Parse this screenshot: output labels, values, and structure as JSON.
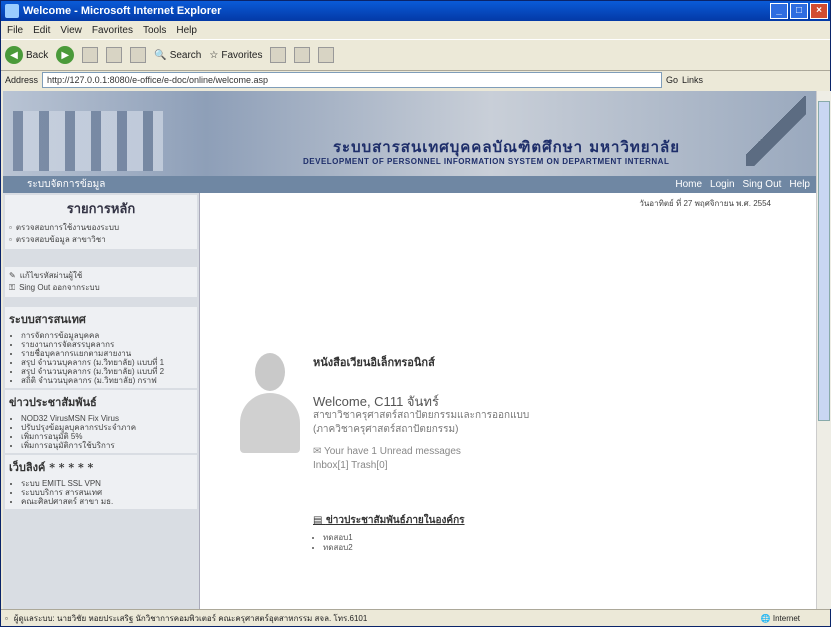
{
  "window": {
    "title": "Welcome - Microsoft Internet Explorer"
  },
  "menu": [
    "File",
    "Edit",
    "View",
    "Favorites",
    "Tools",
    "Help"
  ],
  "toolbar": {
    "back": "Back",
    "search": "Search",
    "favorites": "Favorites"
  },
  "address": {
    "label": "Address",
    "url": "http://127.0.0.1:8080/e-office/e-doc/online/welcome.asp",
    "go": "Go",
    "links": "Links"
  },
  "banner": {
    "title_th": "ระบบสารสนเทศบุคคลบัณฑิตศึกษา มหาวิทยาลัย",
    "title_en": "DEVELOPMENT OF PERSONNEL INFORMATION SYSTEM ON DEPARTMENT INTERNAL"
  },
  "nav": {
    "left": "ระบบจัดการข้อมูล",
    "home": "Home",
    "login": "Login",
    "signout": "Sing Out",
    "help": "Help"
  },
  "sidebar": {
    "main_title": "รายการหลัก",
    "main_items": [
      "ตรวจสอบการใช้งานของระบบ",
      "ตรวจสอบข้อมูล สาขาวิชา"
    ],
    "tool_items": [
      "แก้ไขรหัสผ่านผู้ใช้",
      "Sing Out ออกจากระบบ"
    ],
    "system_title": "ระบบสารสนเทศ",
    "system_items": [
      "การจัดการข้อมูลบุคคล",
      "รายงานการจัดสรรบุคลากร",
      "รายชื่อบุคลากรแยกตามสายงาน",
      "สรุป จำนวนบุคลากร (ม.วิทยาลัย) แบบที่ 1",
      "สรุป จำนวนบุคลากร (ม.วิทยาลัย) แบบที่ 2",
      "สถิติ จำนวนบุคลากร (ม.วิทยาลัย) กราฟ"
    ],
    "news_title": "ข่าวประชาสัมพันธ์",
    "news_items": [
      "NOD32 VirusMSN Fix Virus",
      "ปรับปรุงข้อมูลบุคลากรประจำภาค",
      "เพิ่มการอนุมัติ 5%",
      "เพิ่มการอนุมัติการใช้บริการ"
    ],
    "links_title": "เว็บลิงค์ * * * * *",
    "links_items": [
      "ระบบ EMITL SSL VPN",
      "ระบบบริการ สารสนเทศ",
      "คณะศิลปศาสตร์ สาขา มธ."
    ]
  },
  "main": {
    "date": "วันอาทิตย์ ที่ 27 พฤศจิกายน พ.ศ. 2554",
    "heading": "หนังสือเวียนอิเล็กทรอนิกส์",
    "welcome": "Welcome, C111   จันทร์",
    "dept": "สาขาวิชาครุศาสตร์สถาปัตยกรรมและการออกแบบ (ภาควิชาครุศาสตร์สถาปัตยกรรม)",
    "unread": "Your have 1  Unread messages",
    "boxes": "Inbox[1]  Trash[0]",
    "ann_heading": "ข่าวประชาสัมพันธ์ภายในองค์กร",
    "ann_items": [
      "ทดสอบ1",
      "ทดสอบ2"
    ]
  },
  "status": {
    "text": "ผู้ดูแลระบบ: นายวิชัย หอยประเสริฐ นักวิชาการคอมพิวเตอร์ คณะครุศาสตร์อุตสาหกรรม สจล. โทร.6101",
    "zone": "Internet"
  }
}
